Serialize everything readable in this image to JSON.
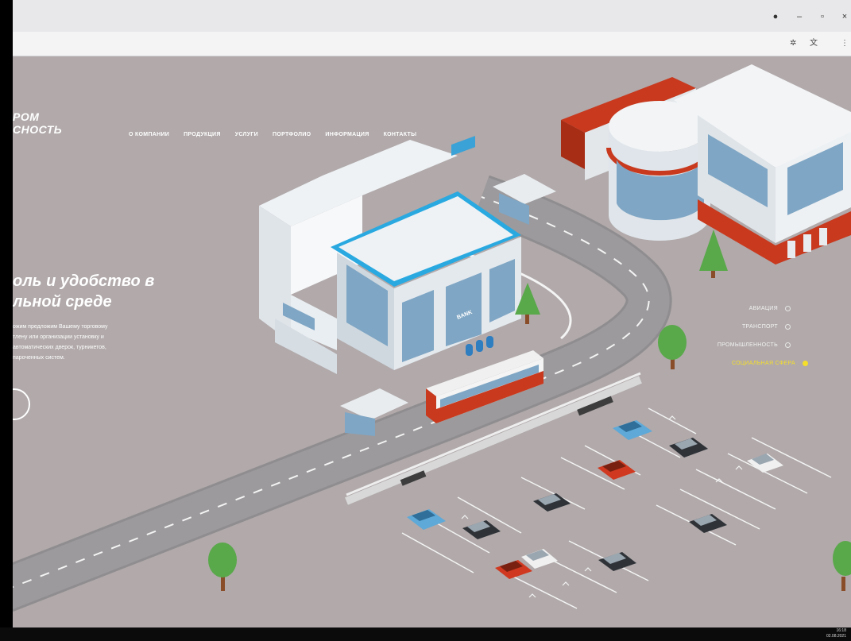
{
  "browser": {
    "profile_icon": "user-avatar-icon",
    "minimize_icon": "minimize-icon",
    "restore_icon": "restore-icon",
    "close_icon": "close-icon",
    "extension_icon": "extension-icon",
    "translate_icon": "translate-icon",
    "menu_icon": "more-vertical-icon"
  },
  "site": {
    "logo_line1": "РОМ",
    "logo_line2": "СНОСТЬ",
    "nav": [
      {
        "label": "О КОМПАНИИ"
      },
      {
        "label": "ПРОДУКЦИЯ"
      },
      {
        "label": "УСЛУГИ"
      },
      {
        "label": "ПОРТФОЛИО"
      },
      {
        "label": "ИНФОРМАЦИЯ"
      },
      {
        "label": "КОНТАКТЫ"
      }
    ],
    "hero": {
      "title_line1": "оль и удобство в",
      "title_line2": "льной среде",
      "text_line1": "ожим предложим Вашему торговому",
      "text_line2": "тлену или организации установку и",
      "text_line3": "автоматических дверок, турникетов,",
      "text_line4": "пароченных систем."
    },
    "sectors": [
      {
        "label": "АВИАЦИЯ",
        "active": false
      },
      {
        "label": "ТРАНСПОРТ",
        "active": false
      },
      {
        "label": "ПРОМЫШЛЕННОСТЬ",
        "active": false
      },
      {
        "label": "СОЦИАЛЬНАЯ СФЕРА",
        "active": true
      }
    ],
    "bank_sign": "BANK"
  },
  "colors": {
    "background": "#b1a9aa",
    "accent_active": "#f5df2a",
    "bank_trim": "#29a9e0",
    "roof_red": "#c8391e"
  },
  "taskbar": {
    "time": "16:18",
    "date": "02.08.2021"
  }
}
